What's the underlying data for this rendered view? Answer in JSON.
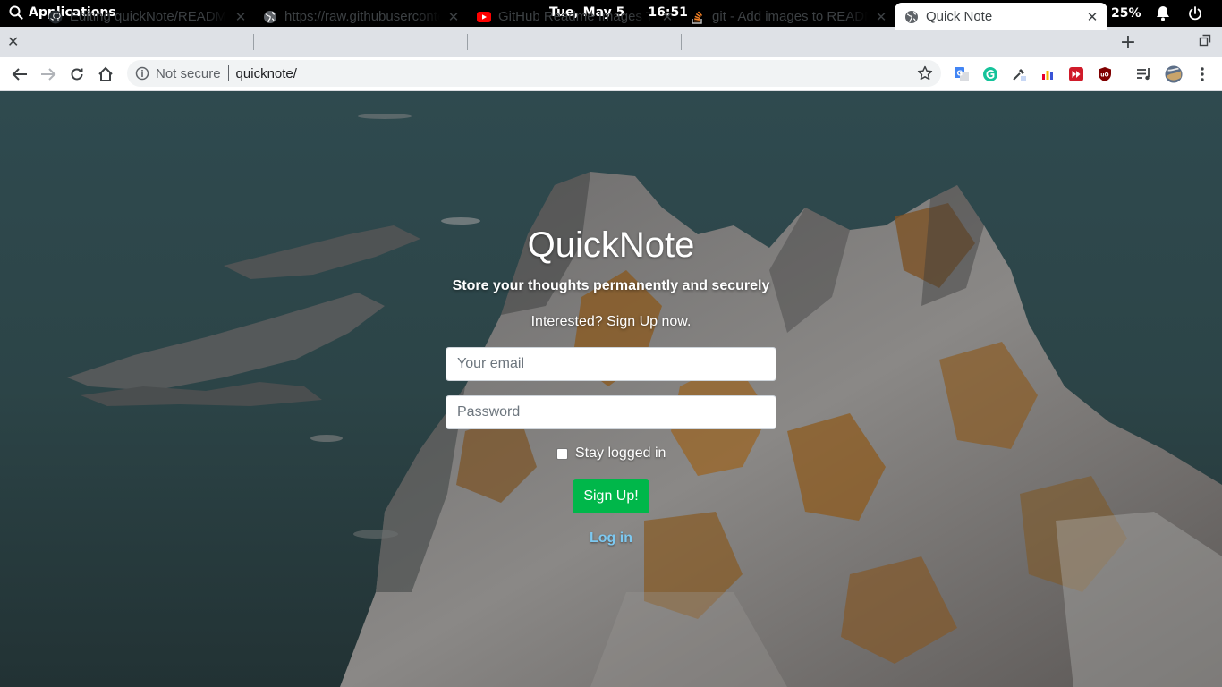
{
  "system_bar": {
    "applications_label": "Applications",
    "date": "Tue, May  5",
    "time": "16:51",
    "battery_percent": "25%"
  },
  "tabs": [
    {
      "title": "Editing quickNote/README.md",
      "icon": "github-icon",
      "active": false
    },
    {
      "title": "https://raw.githubusercontent.com",
      "icon": "globe-icon",
      "active": false
    },
    {
      "title": "GitHub Readme Images T",
      "icon": "youtube-icon",
      "active": false
    },
    {
      "title": "git - Add images to README",
      "icon": "stackoverflow-icon",
      "active": false
    },
    {
      "title": "Quick Note",
      "icon": "globe-icon",
      "active": true
    }
  ],
  "address_bar": {
    "security_label": "Not secure",
    "url": "quicknote/"
  },
  "page": {
    "title": "QuickNote",
    "tagline": "Store your thoughts permanently and securely",
    "invite": "Interested? Sign Up now.",
    "email_placeholder": "Your email",
    "password_placeholder": "Password",
    "stay_logged_in_label": "Stay logged in",
    "stay_logged_in_checked": false,
    "signup_label": "Sign Up!",
    "login_label": "Log in"
  },
  "colors": {
    "signup_button": "#00b74a",
    "login_link": "#7dc8f0"
  }
}
